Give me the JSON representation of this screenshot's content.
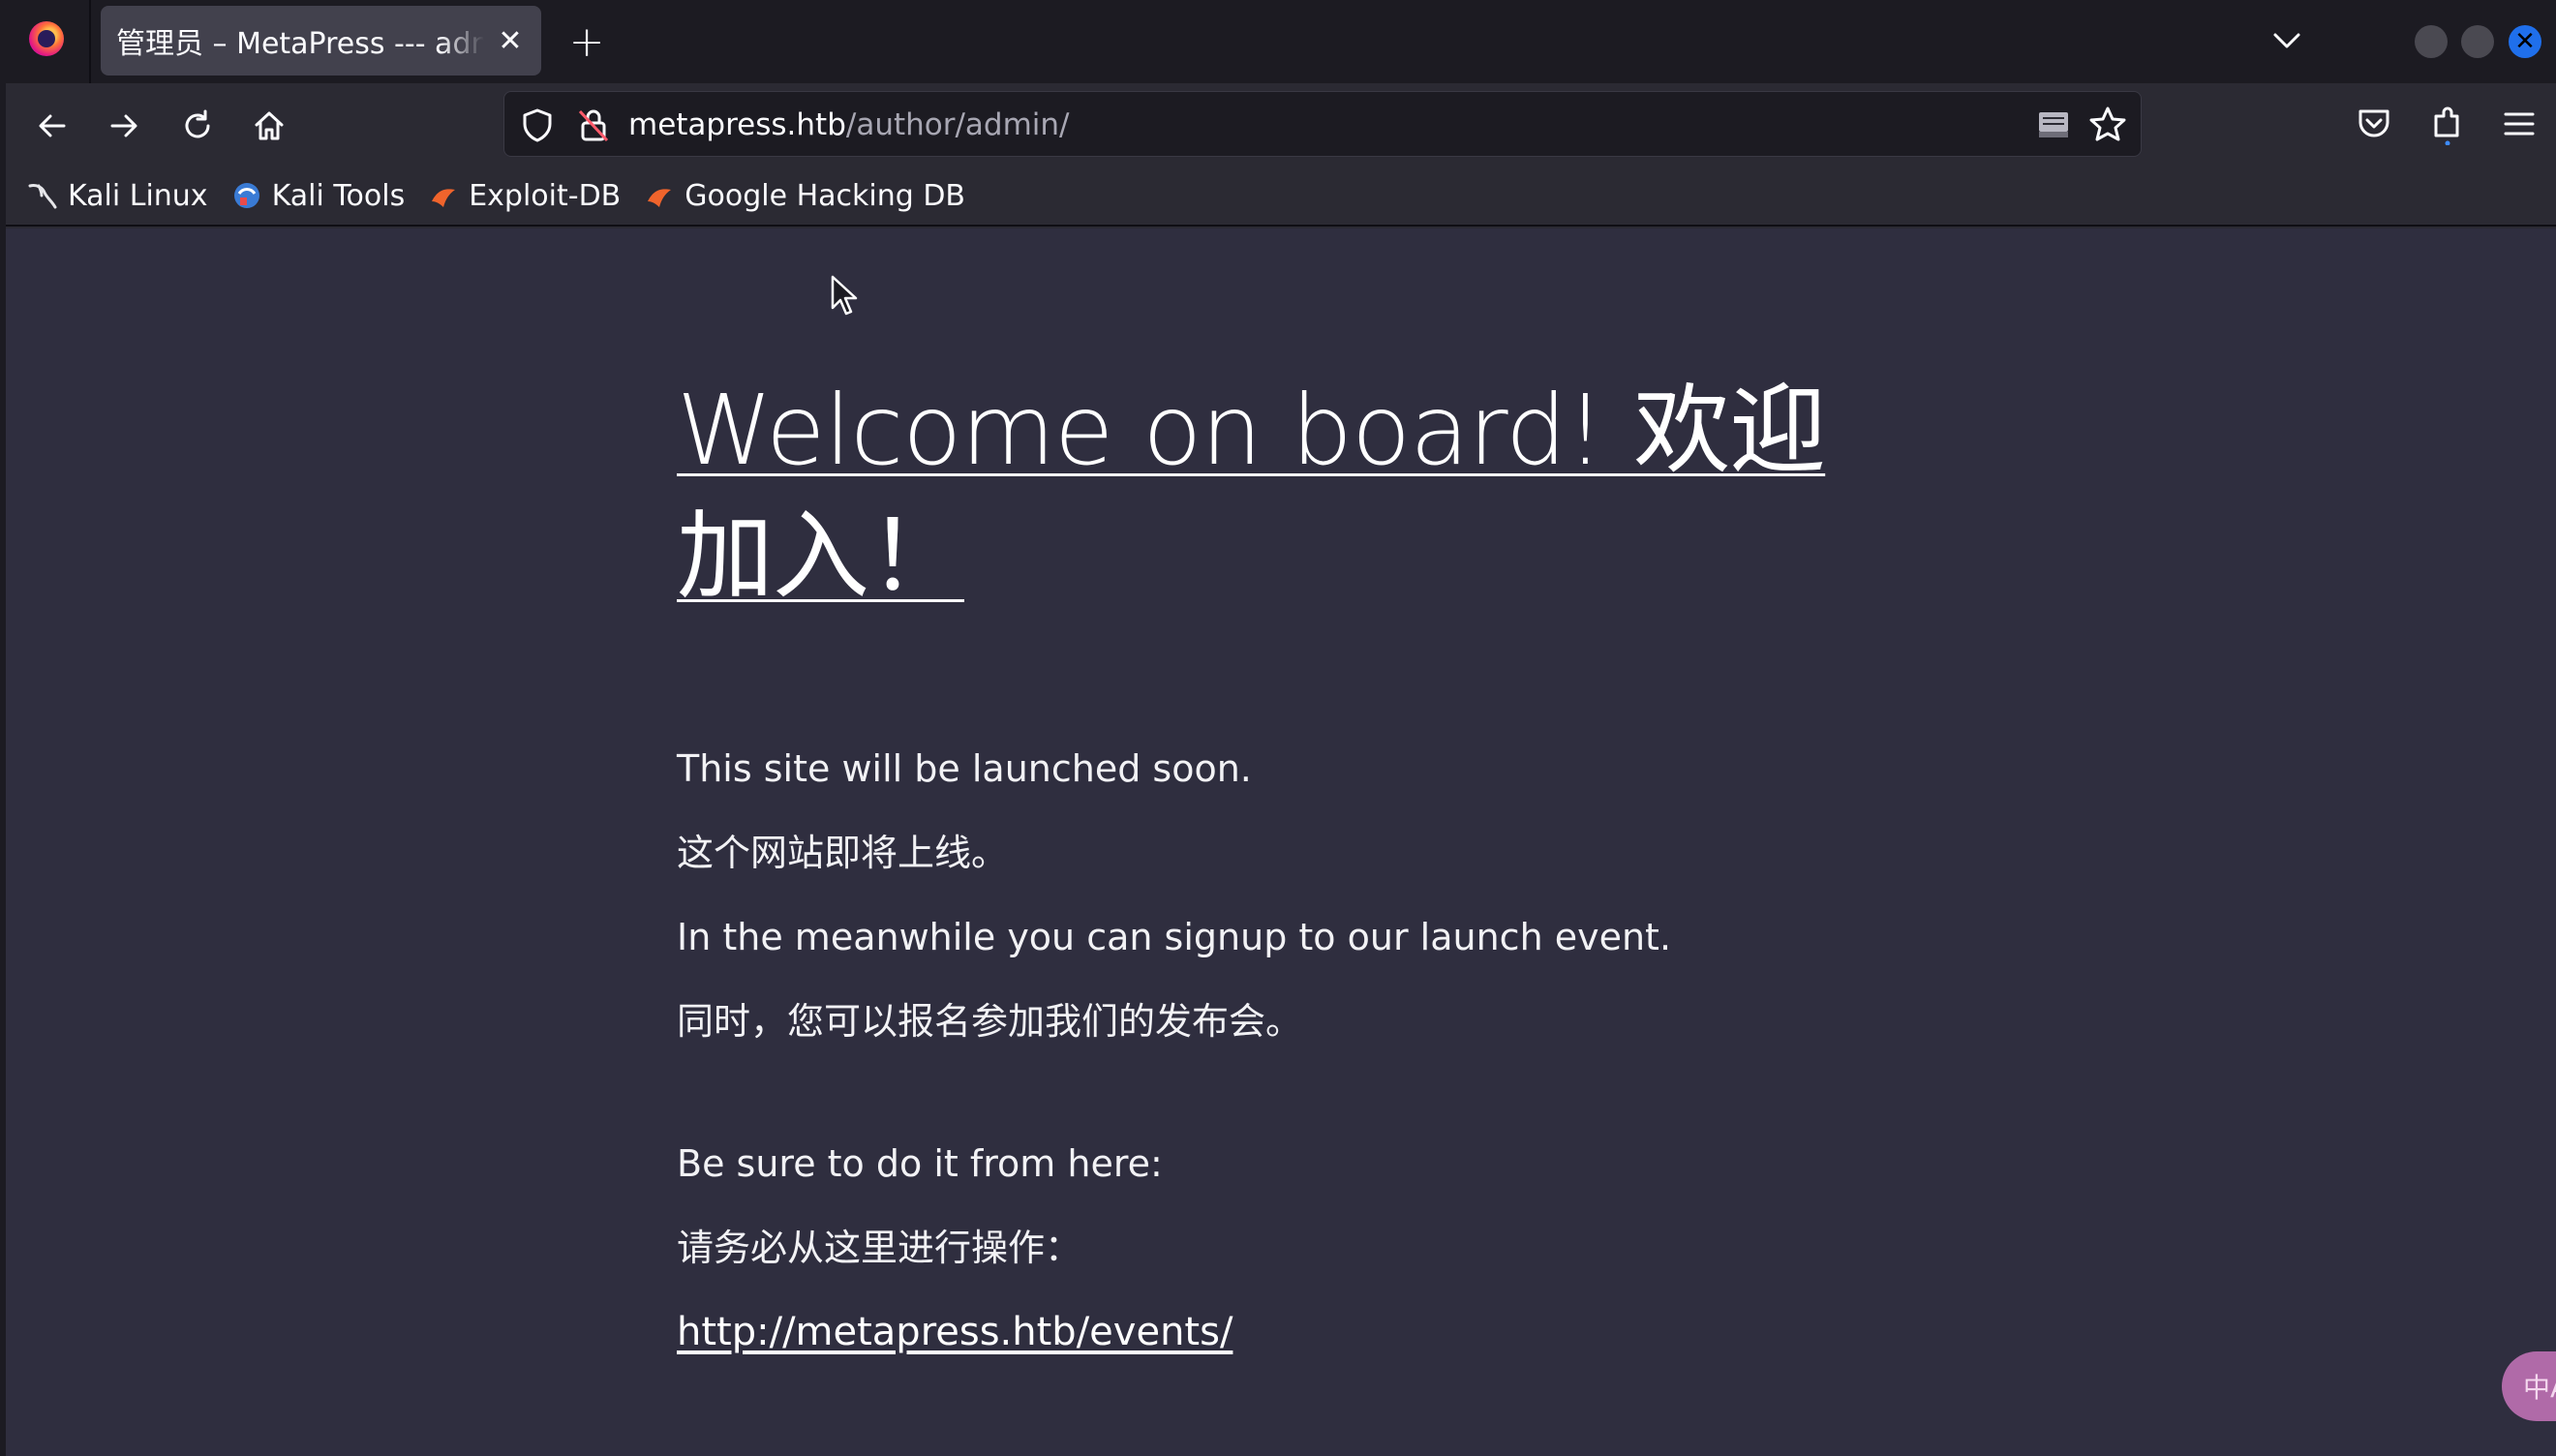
{
  "tab": {
    "title": "管理员 – MetaPress --- admin",
    "close_glyph": "✕"
  },
  "tabstrip": {
    "new_tab_glyph": "+",
    "window_close_glyph": "✕"
  },
  "urlbar": {
    "host": "metapress.htb",
    "path": "/author/admin/"
  },
  "bookmarks": [
    {
      "label": "Kali Linux",
      "icon": "kali-dragon-icon"
    },
    {
      "label": "Kali Tools",
      "icon": "kali-tools-icon"
    },
    {
      "label": "Exploit-DB",
      "icon": "exploit-db-icon"
    },
    {
      "label": "Google Hacking DB",
      "icon": "ghdb-icon"
    }
  ],
  "page": {
    "title": "Welcome on board! 欢迎加入！",
    "paragraphs": [
      "This site will be launched soon.",
      "这个网站即将上线。",
      "In the meanwhile you can signup to our launch event.",
      "同时，您可以报名参加我们的发布会。",
      "Be sure to do it from here:",
      "请务必从这里进行操作："
    ],
    "link": "http://metapress.htb/events/"
  },
  "translate_badge": {
    "label": "中A"
  },
  "colors": {
    "tabstrip_bg": "#1c1b22",
    "toolbar_bg": "#2b2a33",
    "page_bg": "#2f2e3f",
    "active_tab_bg": "#42414d",
    "accent": "#1f6feb"
  }
}
